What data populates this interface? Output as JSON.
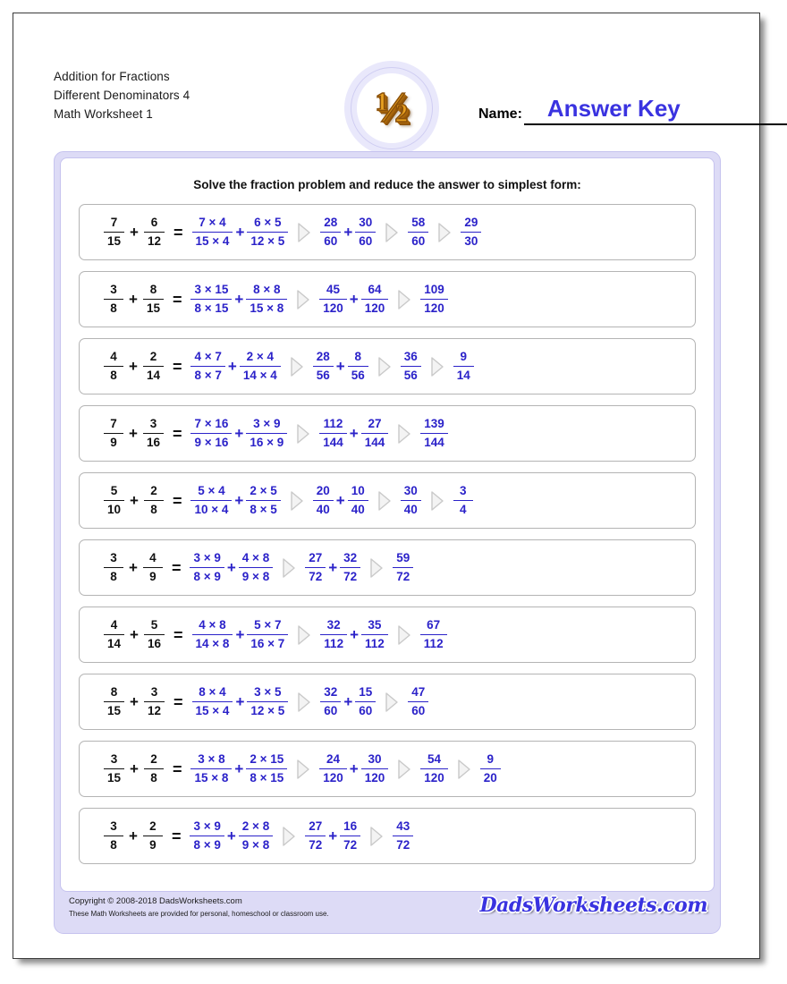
{
  "header": {
    "title_lines": [
      "Addition for Fractions",
      "Different Denominators 4",
      "Math Worksheet 1"
    ],
    "logo_glyph": "½",
    "name_label": "Name:",
    "name_value": "Answer Key"
  },
  "instructions": "Solve the fraction problem and reduce the answer to simplest form:",
  "colors": {
    "answer_blue": "#2b22c9",
    "panel_lavender": "#dddbf6",
    "panel_border": "#c6c3ef",
    "problem_border": "#b4b4b4",
    "logo_gold": "#e8a020"
  },
  "symbols": {
    "plus": "+",
    "equals": "=",
    "times": "×",
    "arrow": "arrow-right-triangle"
  },
  "problems": [
    {
      "a": {
        "n": "7",
        "d": "15"
      },
      "b": {
        "n": "6",
        "d": "12"
      },
      "step1a": {
        "n": "7 × 4",
        "d": "15 × 4"
      },
      "step1b": {
        "n": "6 × 5",
        "d": "12 × 5"
      },
      "step2a": {
        "n": "28",
        "d": "60"
      },
      "step2b": {
        "n": "30",
        "d": "60"
      },
      "sum": {
        "n": "58",
        "d": "60"
      },
      "reduced": {
        "n": "29",
        "d": "30"
      }
    },
    {
      "a": {
        "n": "3",
        "d": "8"
      },
      "b": {
        "n": "8",
        "d": "15"
      },
      "step1a": {
        "n": "3 × 15",
        "d": "8 × 15"
      },
      "step1b": {
        "n": "8 × 8",
        "d": "15 × 8"
      },
      "step2a": {
        "n": "45",
        "d": "120"
      },
      "step2b": {
        "n": "64",
        "d": "120"
      },
      "sum": {
        "n": "109",
        "d": "120"
      },
      "reduced": null
    },
    {
      "a": {
        "n": "4",
        "d": "8"
      },
      "b": {
        "n": "2",
        "d": "14"
      },
      "step1a": {
        "n": "4 × 7",
        "d": "8 × 7"
      },
      "step1b": {
        "n": "2 × 4",
        "d": "14 × 4"
      },
      "step2a": {
        "n": "28",
        "d": "56"
      },
      "step2b": {
        "n": "8",
        "d": "56"
      },
      "sum": {
        "n": "36",
        "d": "56"
      },
      "reduced": {
        "n": "9",
        "d": "14"
      }
    },
    {
      "a": {
        "n": "7",
        "d": "9"
      },
      "b": {
        "n": "3",
        "d": "16"
      },
      "step1a": {
        "n": "7 × 16",
        "d": "9 × 16"
      },
      "step1b": {
        "n": "3 × 9",
        "d": "16 × 9"
      },
      "step2a": {
        "n": "112",
        "d": "144"
      },
      "step2b": {
        "n": "27",
        "d": "144"
      },
      "sum": {
        "n": "139",
        "d": "144"
      },
      "reduced": null
    },
    {
      "a": {
        "n": "5",
        "d": "10"
      },
      "b": {
        "n": "2",
        "d": "8"
      },
      "step1a": {
        "n": "5 × 4",
        "d": "10 × 4"
      },
      "step1b": {
        "n": "2 × 5",
        "d": "8 × 5"
      },
      "step2a": {
        "n": "20",
        "d": "40"
      },
      "step2b": {
        "n": "10",
        "d": "40"
      },
      "sum": {
        "n": "30",
        "d": "40"
      },
      "reduced": {
        "n": "3",
        "d": "4"
      }
    },
    {
      "a": {
        "n": "3",
        "d": "8"
      },
      "b": {
        "n": "4",
        "d": "9"
      },
      "step1a": {
        "n": "3 × 9",
        "d": "8 × 9"
      },
      "step1b": {
        "n": "4 × 8",
        "d": "9 × 8"
      },
      "step2a": {
        "n": "27",
        "d": "72"
      },
      "step2b": {
        "n": "32",
        "d": "72"
      },
      "sum": {
        "n": "59",
        "d": "72"
      },
      "reduced": null
    },
    {
      "a": {
        "n": "4",
        "d": "14"
      },
      "b": {
        "n": "5",
        "d": "16"
      },
      "step1a": {
        "n": "4 × 8",
        "d": "14 × 8"
      },
      "step1b": {
        "n": "5 × 7",
        "d": "16 × 7"
      },
      "step2a": {
        "n": "32",
        "d": "112"
      },
      "step2b": {
        "n": "35",
        "d": "112"
      },
      "sum": {
        "n": "67",
        "d": "112"
      },
      "reduced": null
    },
    {
      "a": {
        "n": "8",
        "d": "15"
      },
      "b": {
        "n": "3",
        "d": "12"
      },
      "step1a": {
        "n": "8 × 4",
        "d": "15 × 4"
      },
      "step1b": {
        "n": "3 × 5",
        "d": "12 × 5"
      },
      "step2a": {
        "n": "32",
        "d": "60"
      },
      "step2b": {
        "n": "15",
        "d": "60"
      },
      "sum": {
        "n": "47",
        "d": "60"
      },
      "reduced": null
    },
    {
      "a": {
        "n": "3",
        "d": "15"
      },
      "b": {
        "n": "2",
        "d": "8"
      },
      "step1a": {
        "n": "3 × 8",
        "d": "15 × 8"
      },
      "step1b": {
        "n": "2 × 15",
        "d": "8 × 15"
      },
      "step2a": {
        "n": "24",
        "d": "120"
      },
      "step2b": {
        "n": "30",
        "d": "120"
      },
      "sum": {
        "n": "54",
        "d": "120"
      },
      "reduced": {
        "n": "9",
        "d": "20"
      }
    },
    {
      "a": {
        "n": "3",
        "d": "8"
      },
      "b": {
        "n": "2",
        "d": "9"
      },
      "step1a": {
        "n": "3 × 9",
        "d": "8 × 9"
      },
      "step1b": {
        "n": "2 × 8",
        "d": "9 × 8"
      },
      "step2a": {
        "n": "27",
        "d": "72"
      },
      "step2b": {
        "n": "16",
        "d": "72"
      },
      "sum": {
        "n": "43",
        "d": "72"
      },
      "reduced": null
    }
  ],
  "footer": {
    "copyright": "Copyright © 2008-2018 DadsWorksheets.com",
    "usage": "These Math Worksheets are provided for personal, homeschool or classroom use.",
    "brand": "DadsWorksheets.com"
  }
}
